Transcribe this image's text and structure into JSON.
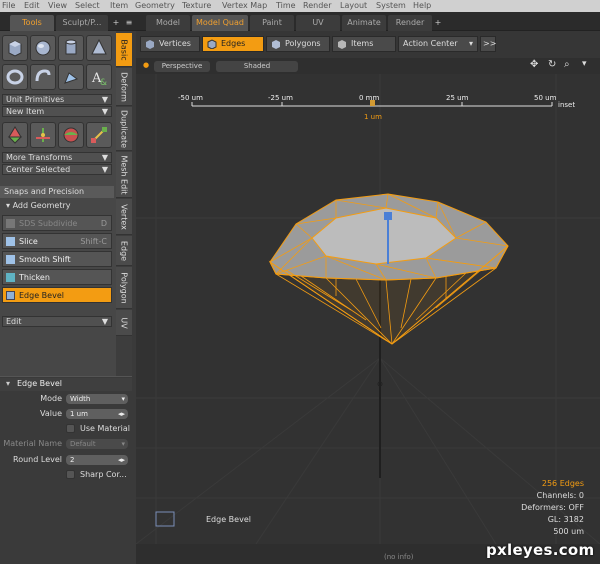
{
  "menu": [
    "File",
    "Edit",
    "View",
    "Select",
    "Item",
    "Geometry",
    "Texture",
    "Vertex Map",
    "Time",
    "Render",
    "Layout",
    "System",
    "Help"
  ],
  "left_tabs": {
    "tools": "Tools",
    "sculpt": "Sculpt/P...",
    "plus": "+",
    "menu": "≡"
  },
  "layout_tabs": [
    {
      "label": "Model",
      "active": false
    },
    {
      "label": "Model Quad",
      "active": true
    },
    {
      "label": "Paint",
      "active": false
    },
    {
      "label": "UV",
      "active": false
    },
    {
      "label": "Animate",
      "active": false
    },
    {
      "label": "Render",
      "active": false
    },
    {
      "label": "+",
      "active": false
    }
  ],
  "vertical_tabs": [
    "Basic",
    "Deform",
    "Duplicate",
    "Mesh Edit",
    "Vertex",
    "Edge",
    "Polygon",
    "UV"
  ],
  "toolbox": {
    "unit_primitives": "Unit Primitives",
    "new_item": "New Item",
    "more_transforms": "More Transforms",
    "center_selected": "Center Selected",
    "snaps": "Snaps and Precision",
    "add_geometry": "Add Geometry",
    "tools": [
      {
        "label": "SDS Subdivide",
        "shortcut": "D",
        "state": "disabled"
      },
      {
        "label": "Slice",
        "shortcut": "Shift-C",
        "state": "normal"
      },
      {
        "label": "Smooth Shift",
        "shortcut": "",
        "state": "normal"
      },
      {
        "label": "Thicken",
        "shortcut": "",
        "state": "normal"
      },
      {
        "label": "Edge Bevel",
        "shortcut": "",
        "state": "active"
      }
    ],
    "edit": "Edit"
  },
  "properties": {
    "title": "Edge Bevel",
    "mode_label": "Mode",
    "mode_value": "Width",
    "value_label": "Value",
    "value_value": "1 um",
    "use_material": "Use Material",
    "material_name_label": "Material Name",
    "material_name_value": "Default",
    "round_level_label": "Round Level",
    "round_level_value": "2",
    "sharp_corners": "Sharp Cor..."
  },
  "viewport_toolbar": {
    "vertices": "Vertices",
    "edges": "Edges",
    "polygons": "Polygons",
    "items": "Items",
    "action_center": "Action Center",
    "more": ">>"
  },
  "viewport": {
    "view": "Perspective",
    "shading": "Shaded",
    "ruler": [
      "-50 um",
      "-25 um",
      "0 mm",
      "25 um",
      "50 um"
    ],
    "ruler_value": "1 um",
    "ruler_mode": "inset",
    "tool_name": "Edge Bevel",
    "stats": {
      "edges": "256 Edges",
      "channels": "Channels: 0",
      "deformers": "Deformers: OFF",
      "gl": "GL: 3182",
      "scale": "500 um"
    }
  },
  "statusbar": "(no info)",
  "watermark": "pxleyes.com",
  "colors": {
    "accent": "#f39c12",
    "panel": "#474747",
    "viewport": "#323232"
  }
}
